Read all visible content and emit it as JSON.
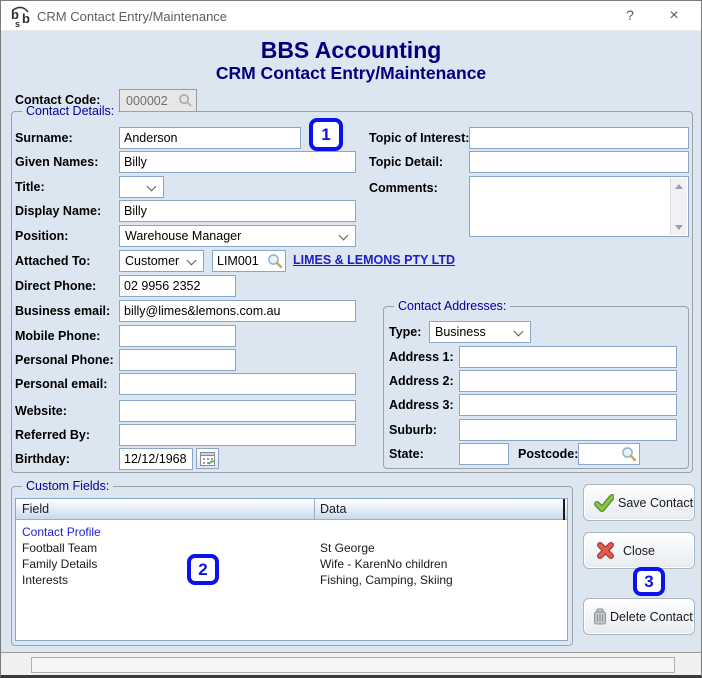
{
  "colors": {
    "panel_bg": "#dce6f1",
    "heading_navy": "#00007d",
    "group_label_navy": "#00009b",
    "marker_blue": "#0b13ea",
    "link_blue": "#1c1ccc",
    "table_link_blue": "#1a1adf",
    "input_border": "#89a7c5"
  },
  "icons": {
    "app_logo": "bsb-logo-icon",
    "lookup": "magnifier-icon",
    "calendar": "calendar-icon",
    "save": "green-check-icon",
    "close": "red-x-icon",
    "delete": "trash-icon"
  },
  "titlebar": {
    "title": "CRM Contact Entry/Maintenance",
    "help_glyph": "?",
    "close_glyph": "×"
  },
  "header": {
    "title": "BBS Accounting",
    "subtitle": "CRM Contact Entry/Maintenance"
  },
  "contact_code": {
    "label": "Contact Code:",
    "value": "000002"
  },
  "markers": {
    "m1": "1",
    "m2": "2",
    "m3": "3"
  },
  "details": {
    "legend": "Contact Details:",
    "surname": {
      "label": "Surname:",
      "value": "Anderson"
    },
    "given_names": {
      "label": "Given Names:",
      "value": "Billy"
    },
    "title": {
      "label": "Title:",
      "value": ""
    },
    "display_name": {
      "label": "Display Name:",
      "value": "Billy"
    },
    "position": {
      "label": "Position:",
      "value": "Warehouse Manager"
    },
    "attached_to": {
      "label": "Attached To:",
      "type_value": "Customer",
      "code_value": "LIM001",
      "link": "LIMES & LEMONS PTY LTD"
    },
    "direct_phone": {
      "label": "Direct Phone:",
      "value": "02 9956 2352"
    },
    "business_email": {
      "label": "Business email:",
      "value": "billy@limes&lemons.com.au"
    },
    "mobile_phone": {
      "label": "Mobile Phone:",
      "value": ""
    },
    "personal_phone": {
      "label": "Personal Phone:",
      "value": ""
    },
    "personal_email": {
      "label": "Personal email:",
      "value": ""
    },
    "website": {
      "label": "Website:",
      "value": ""
    },
    "referred_by": {
      "label": "Referred By:",
      "value": ""
    },
    "birthday": {
      "label": "Birthday:",
      "value": "12/12/1968"
    },
    "topic_of_interest": {
      "label": "Topic of Interest:",
      "value": ""
    },
    "topic_detail": {
      "label": "Topic Detail:",
      "value": ""
    },
    "comments": {
      "label": "Comments:",
      "value": ""
    }
  },
  "addresses": {
    "legend": "Contact Addresses:",
    "type": {
      "label": "Type:",
      "value": "Business"
    },
    "address1": {
      "label": "Address 1:",
      "value": ""
    },
    "address2": {
      "label": "Address 2:",
      "value": ""
    },
    "address3": {
      "label": "Address 3:",
      "value": ""
    },
    "suburb": {
      "label": "Suburb:",
      "value": ""
    },
    "state": {
      "label": "State:",
      "value": ""
    },
    "postcode": {
      "label": "Postcode:",
      "value": ""
    }
  },
  "custom_fields": {
    "legend": "Custom Fields:",
    "columns": {
      "field": "Field",
      "data": "Data"
    },
    "rows": [
      {
        "field": "Contact Profile",
        "data": ""
      },
      {
        "field": "Football Team",
        "data": "St George"
      },
      {
        "field": "Family Details",
        "data": "Wife - KarenNo children"
      },
      {
        "field": "Interests",
        "data": "Fishing, Camping, Skiing"
      }
    ]
  },
  "buttons": {
    "save": {
      "label": "Save Contact"
    },
    "close": {
      "label": "Close"
    },
    "delete": {
      "label": "Delete Contact"
    }
  }
}
